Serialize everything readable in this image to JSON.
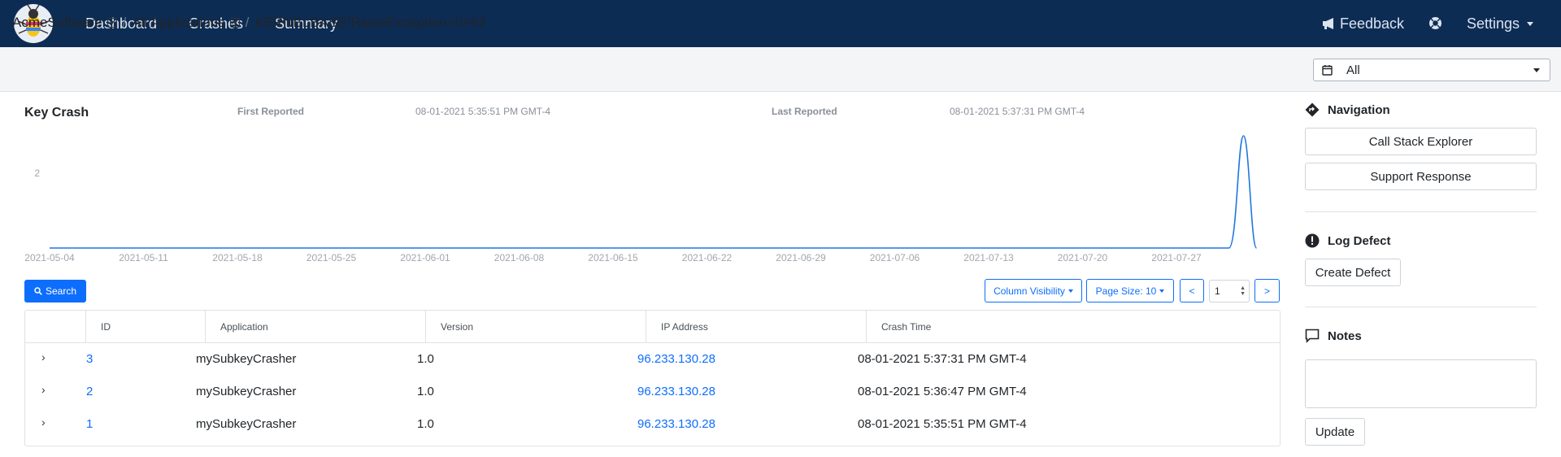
{
  "nav": {
    "links": [
      "Dashboard",
      "Crashes",
      "Summary"
    ],
    "feedback": "Feedback",
    "settings": "Settings",
    "bg_color": "#0d2c54"
  },
  "breadcrumb": {
    "items": [
      "AcmeSoftware",
      "All Applications",
      "KERNELBASE!RaiseException+0×62"
    ]
  },
  "date_filter": {
    "value": "All"
  },
  "key_crash": {
    "title": "Key Crash",
    "first_reported_label": "First Reported",
    "first_reported_value": "08-01-2021 5:35:51 PM GMT-4",
    "last_reported_label": "Last Reported",
    "last_reported_value": "08-01-2021 5:37:31 PM GMT-4"
  },
  "chart_data": {
    "type": "line",
    "x": [
      "2021-05-04",
      "2021-05-11",
      "2021-05-18",
      "2021-05-25",
      "2021-06-01",
      "2021-06-08",
      "2021-06-15",
      "2021-06-22",
      "2021-06-29",
      "2021-07-06",
      "2021-07-13",
      "2021-07-20",
      "2021-07-27",
      "2021-08-01"
    ],
    "series": [
      {
        "values": [
          0,
          0,
          0,
          0,
          0,
          0,
          0,
          0,
          0,
          0,
          0,
          0,
          0,
          3
        ]
      }
    ],
    "x_tick_labels": [
      "2021-05-04",
      "2021-05-11",
      "2021-05-18",
      "2021-05-25",
      "2021-06-01",
      "2021-06-08",
      "2021-06-15",
      "2021-06-22",
      "2021-06-29",
      "2021-07-06",
      "2021-07-13",
      "2021-07-20",
      "2021-07-27"
    ],
    "y_tick_labels": [
      "2"
    ],
    "color": "#1f77e0",
    "grid": false
  },
  "controls": {
    "search": "Search",
    "column_visibility": "Column Visibility",
    "page_size": "Page Size: 10",
    "prev": "<",
    "next": ">",
    "page": "1"
  },
  "table": {
    "headers": [
      "ID",
      "Application",
      "Version",
      "IP Address",
      "Crash Time"
    ],
    "rows": [
      {
        "id": "3",
        "application": "mySubkeyCrasher",
        "version": "1.0",
        "ip": "96.233.130.28",
        "time": "08-01-2021 5:37:31 PM GMT-4"
      },
      {
        "id": "2",
        "application": "mySubkeyCrasher",
        "version": "1.0",
        "ip": "96.233.130.28",
        "time": "08-01-2021 5:36:47 PM GMT-4"
      },
      {
        "id": "1",
        "application": "mySubkeyCrasher",
        "version": "1.0",
        "ip": "96.233.130.28",
        "time": "08-01-2021 5:35:51 PM GMT-4"
      }
    ]
  },
  "sidebar": {
    "navigation_title": "Navigation",
    "call_stack": "Call Stack Explorer",
    "support_response": "Support Response",
    "log_defect_title": "Log Defect",
    "create_defect": "Create Defect",
    "notes_title": "Notes",
    "notes_value": "",
    "update": "Update"
  }
}
